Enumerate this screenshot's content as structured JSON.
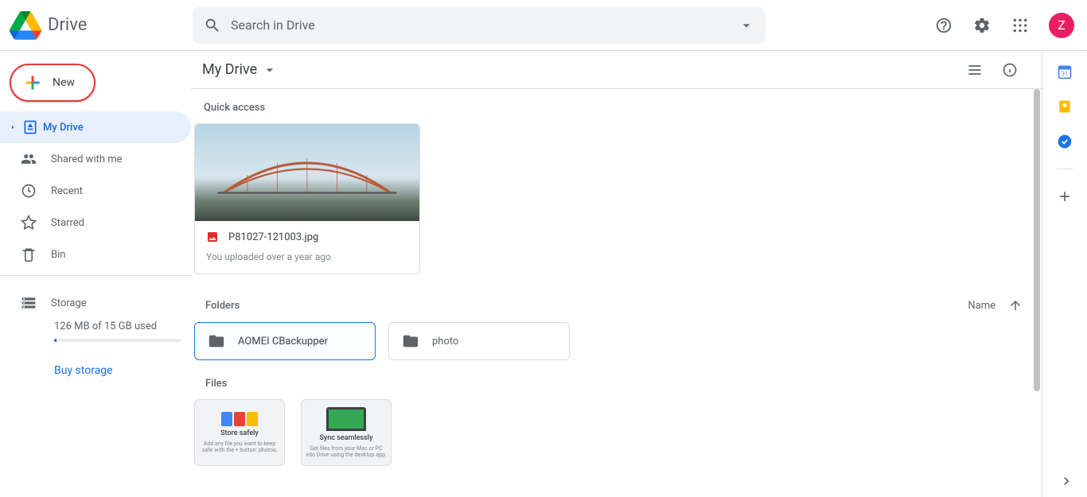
{
  "header": {
    "app_name": "Drive",
    "search_placeholder": "Search in Drive",
    "avatar_initial": "Z"
  },
  "sidebar": {
    "new_label": "New",
    "items": [
      {
        "label": "My Drive"
      },
      {
        "label": "Shared with me"
      },
      {
        "label": "Recent"
      },
      {
        "label": "Starred"
      },
      {
        "label": "Bin"
      }
    ],
    "storage_label": "Storage",
    "storage_usage": "126 MB of 15 GB used",
    "buy_label": "Buy storage"
  },
  "main": {
    "breadcrumb": "My Drive",
    "quick_access_label": "Quick access",
    "quick_access": {
      "filename": "P81027-121003.jpg",
      "subtitle": "You uploaded over a year ago"
    },
    "folders_label": "Folders",
    "sort_label": "Name",
    "folders": [
      {
        "name": "AOMEI CBackupper"
      },
      {
        "name": "photo"
      }
    ],
    "files_label": "Files",
    "files": [
      {
        "title": "Store safely",
        "sub": "Add any file you want to keep safe with the + button: photos,"
      },
      {
        "title": "Sync seamlessly",
        "sub": "Get files from your Mac or PC into Drive using the desktop app."
      }
    ]
  }
}
